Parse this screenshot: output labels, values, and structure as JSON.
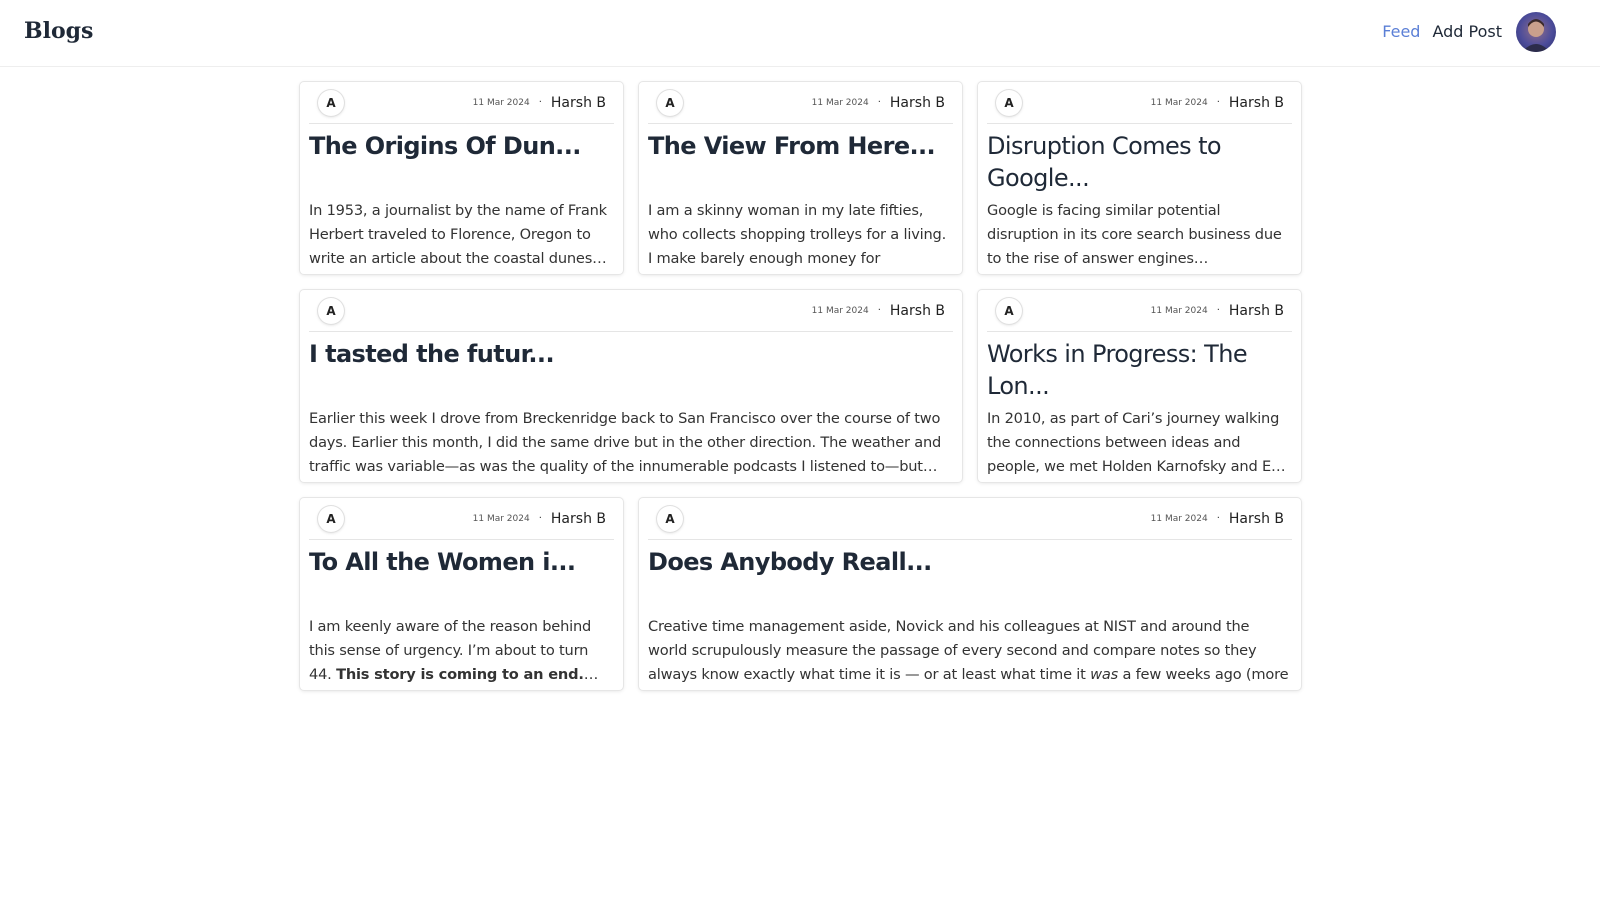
{
  "header": {
    "logo": "Blogs",
    "nav": {
      "feed": "Feed",
      "add_post": "Add Post"
    },
    "accent_color": "#5b7fd6"
  },
  "posts": [
    {
      "initial": "A",
      "date": "11 Mar 2024",
      "separator": "·",
      "author": "Harsh B",
      "title": "The Origins Of Dun...",
      "excerpt": "In 1953, a journalist by the name of Frank Herbert traveled to Florence, Oregon to write an article about the coastal dunes…"
    },
    {
      "initial": "A",
      "date": "11 Mar 2024",
      "separator": "·",
      "author": "Harsh B",
      "title": "The View From Here...",
      "excerpt": "I am a skinny woman in my late fifties, who collects shopping trolleys for a living. I make barely enough money for survival,…"
    },
    {
      "initial": "A",
      "date": "11 Mar 2024",
      "separator": "·",
      "author": "Harsh B",
      "title": "Disruption Comes to Google...",
      "excerpt": "Google is facing similar potential disruption in its core search business due to the rise of answer engines…"
    },
    {
      "initial": "A",
      "date": "11 Mar 2024",
      "separator": "·",
      "author": "Harsh B",
      "title": "I tasted the futur...",
      "excerpt": "Earlier this week I drove from Breckenridge back to San Francisco over the course of two days. Earlier this month, I did the same drive but in the other direction. The weather and traffic was variable—as was the quality of the innumerable podcasts I listened to—but…"
    },
    {
      "initial": "A",
      "date": "11 Mar 2024",
      "separator": "·",
      "author": "Harsh B",
      "title": "Works in Progress: The Lon...",
      "excerpt": "In 2010, as part of Cari’s journey walking the connections between ideas and people, we met Holden Karnofsky and E…"
    },
    {
      "initial": "A",
      "date": "11 Mar 2024",
      "separator": "·",
      "author": "Harsh B",
      "title": "To All the Women i...",
      "excerpt_lead": "I am keenly aware of the reason behind this sense of urgency. I’m about to turn 44. ",
      "excerpt_bold": "This story is coming to an end.",
      "excerpt_tail": "…"
    },
    {
      "initial": "A",
      "date": "11 Mar 2024",
      "separator": "·",
      "author": "Harsh B",
      "title": "Does Anybody Reall...",
      "excerpt_lead": "Creative time management aside, Novick and his colleagues at NIST and around the world scrupulously measure the passage of every second and compare notes so they always know exactly what time it is — or at least what time it ",
      "excerpt_italic": "was",
      "excerpt_tail": " a few weeks ago (more on th…"
    }
  ]
}
